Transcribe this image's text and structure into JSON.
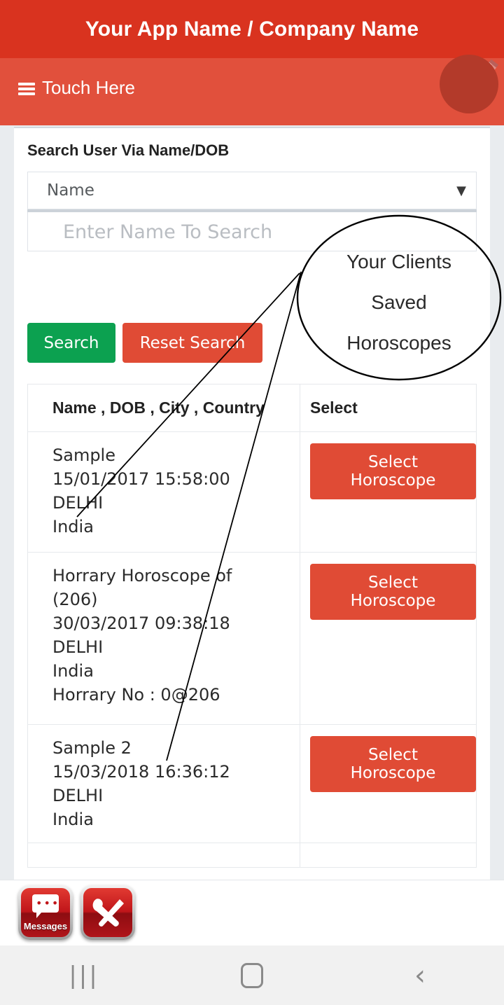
{
  "header": {
    "app_title": "Your App Name / Company Name",
    "menu_label": "Touch Here",
    "menu_icon": "hamburger-icon",
    "avatar_icon": "user-edit-avatar-icon"
  },
  "search_panel": {
    "title": "Search User Via Name/DOB",
    "field_type": {
      "selected": "Name",
      "caret": "▼"
    },
    "search_input": {
      "value": "",
      "placeholder": "Enter Name To Search"
    },
    "buttons": {
      "search": "Search",
      "reset": "Reset Search"
    },
    "colors": {
      "search_green": "#0ca150",
      "reset_red": "#e04b35",
      "header_red": "#d9331f",
      "nav_red": "#e1503c"
    }
  },
  "table": {
    "headers": [
      "Name , DOB , City , Country",
      "Select"
    ],
    "rows": [
      {
        "lines": [
          "Sample",
          "15/01/2017 15:58:00",
          "DELHI",
          "India"
        ],
        "action": "Select Horoscope"
      },
      {
        "lines": [
          "Horrary Horoscope of",
          "(206)",
          "30/03/2017 09:38:18",
          "DELHI",
          "India",
          "Horrary No : 0@206"
        ],
        "action": "Select Horoscope"
      },
      {
        "lines": [
          "Sample 2",
          "15/03/2018 16:36:12",
          "DELHI",
          "India"
        ],
        "action": "Select Horoscope"
      }
    ]
  },
  "annotation": {
    "line1": "Your Clients",
    "line2": "Saved",
    "line3": "Horoscopes"
  },
  "shortcuts": [
    {
      "name": "Messages",
      "icon": "messages-icon"
    },
    {
      "name": "",
      "icon": "tools-icon"
    }
  ],
  "android_nav": {
    "recents_icon": "|||",
    "home_icon": "home-square-icon",
    "back_icon": "‹"
  }
}
